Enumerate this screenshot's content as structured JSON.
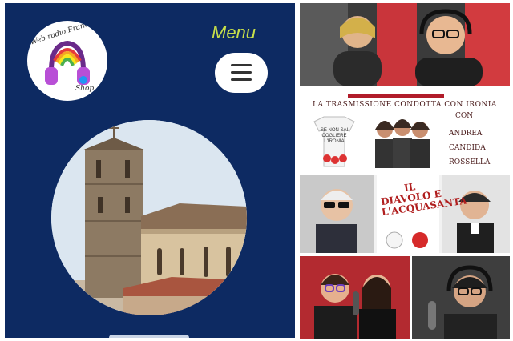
{
  "app": {
    "logo_text": "Web radio Francesco",
    "logo_shop": "Shop",
    "menu_label": "Menu"
  },
  "collage": {
    "show_title": "LA TRASMISSIONE CONDOTTA CON IRONIA",
    "con_label": "CON",
    "hosts": [
      "ANDREA",
      "CANDIDA",
      "ROSSELLA"
    ],
    "shirt_text": "SE NON SAI COGLIERE L'IRONIA",
    "poster_title": "IL DIAVOLO E L'ACQUASANTA"
  },
  "colors": {
    "phone_background": "#0d2a62",
    "menu_accent": "#c8e04a"
  }
}
